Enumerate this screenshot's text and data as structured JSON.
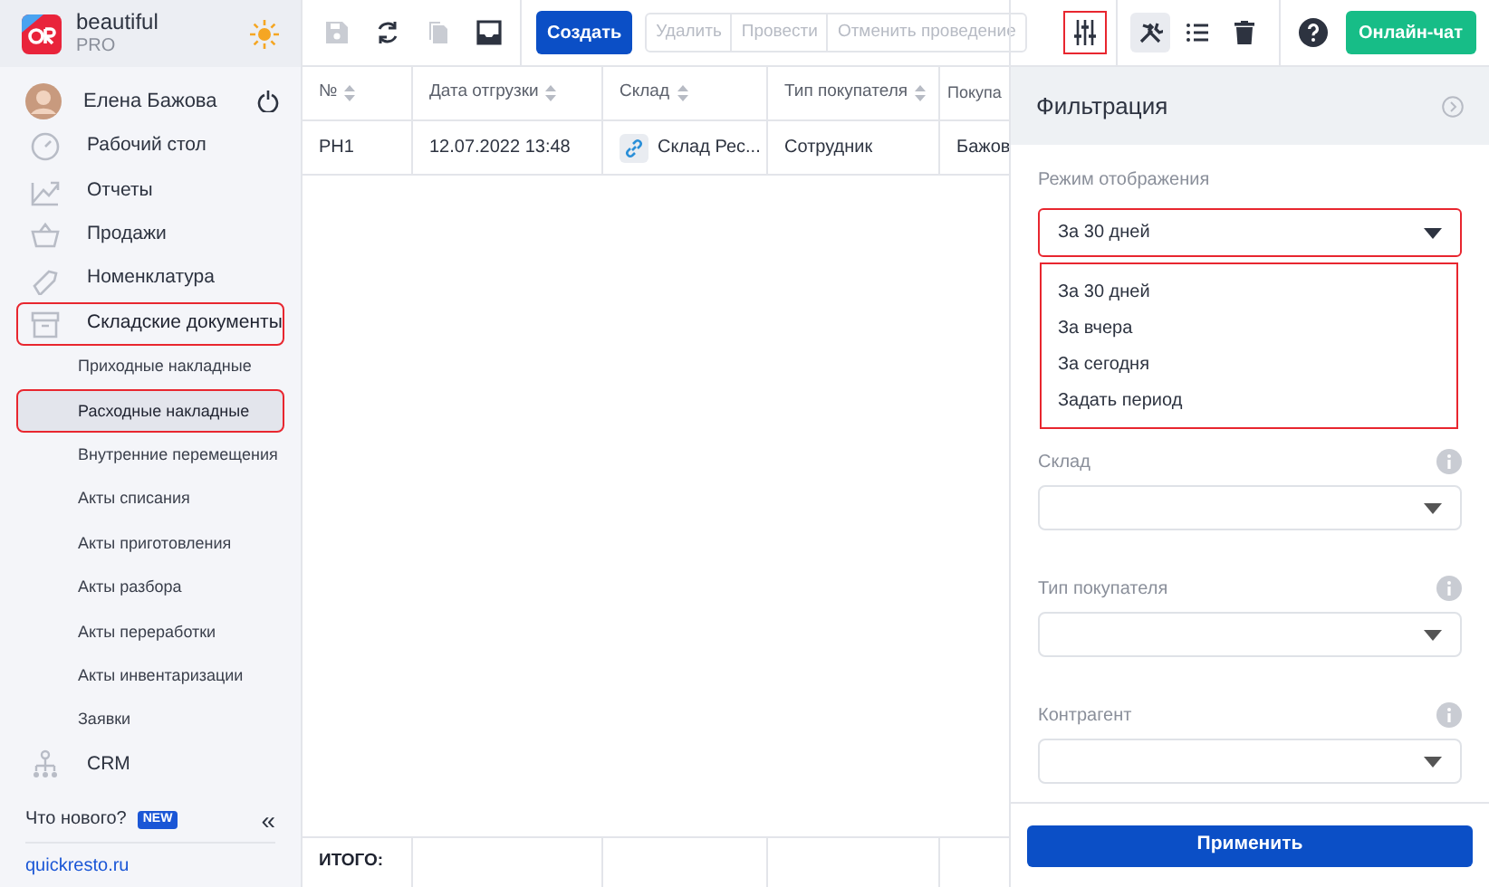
{
  "brand": {
    "name": "beautiful",
    "plan": "PRO"
  },
  "user": {
    "name": "Елена Бажова"
  },
  "sidebar": {
    "items": [
      {
        "kind": "dashboard",
        "label": "Рабочий стол",
        "selected": false,
        "highlighted": false
      },
      {
        "kind": "reports",
        "label": "Отчеты",
        "selected": false,
        "highlighted": false
      },
      {
        "kind": "sales",
        "label": "Продажи",
        "selected": false,
        "highlighted": false
      },
      {
        "kind": "tag",
        "label": "Номенклатура",
        "selected": false,
        "highlighted": false
      },
      {
        "kind": "box",
        "label": "Складские документы",
        "selected": false,
        "highlighted": true,
        "expanded": true,
        "children": [
          {
            "label": "Приходные накладные",
            "selected": false,
            "highlighted": false
          },
          {
            "label": "Расходные накладные",
            "selected": true,
            "highlighted": true
          },
          {
            "label": "Внутренние перемещения",
            "selected": false,
            "highlighted": false
          },
          {
            "label": "Акты списания",
            "selected": false,
            "highlighted": false
          },
          {
            "label": "Акты приготовления",
            "selected": false,
            "highlighted": false
          },
          {
            "label": "Акты разбора",
            "selected": false,
            "highlighted": false
          },
          {
            "label": "Акты переработки",
            "selected": false,
            "highlighted": false
          },
          {
            "label": "Акты инвентаризации",
            "selected": false,
            "highlighted": false
          },
          {
            "label": "Заявки",
            "selected": false,
            "highlighted": false
          }
        ]
      },
      {
        "kind": "org",
        "label": "CRM",
        "selected": false,
        "highlighted": false
      }
    ],
    "whats_new": "Что нового?",
    "new_badge": "NEW",
    "collapse": "«",
    "site_link": "quickresto.ru"
  },
  "toolbar": {
    "icons": [
      {
        "kind": "save",
        "disabled": true
      },
      {
        "kind": "refresh",
        "disabled": false
      },
      {
        "kind": "copy",
        "disabled": true
      },
      {
        "kind": "inbox",
        "disabled": false
      }
    ],
    "create": "Создать",
    "actions": [
      {
        "label": "Удалить",
        "disabled": true
      },
      {
        "label": "Провести",
        "disabled": true
      },
      {
        "label": "Отменить проведение",
        "disabled": true
      }
    ],
    "filter_highlighted": true,
    "tools": [
      {
        "kind": "tools",
        "selected": true
      },
      {
        "kind": "list",
        "selected": false
      },
      {
        "kind": "trash",
        "selected": false
      }
    ],
    "chat": "Онлайн-чат"
  },
  "table": {
    "columns": [
      "№",
      "Дата отгрузки",
      "Склад",
      "Тип покупателя",
      "Покупа"
    ],
    "rows": [
      [
        "РН1",
        "12.07.2022 13:48",
        "Склад Рес...",
        "Сотрудник",
        "Бажов"
      ]
    ],
    "total_label": "ИТОГО:"
  },
  "filter": {
    "title": "Фильтрация",
    "mode": {
      "label": "Режим отображения",
      "value": "За 30 дней",
      "highlighted": true,
      "expanded": true,
      "options": [
        "За 30 дней",
        "За вчера",
        "За сегодня",
        "Задать период"
      ]
    },
    "fields": [
      {
        "label": "Склад"
      },
      {
        "label": "Тип покупателя"
      },
      {
        "label": "Контрагент"
      }
    ],
    "apply": "Применить"
  }
}
